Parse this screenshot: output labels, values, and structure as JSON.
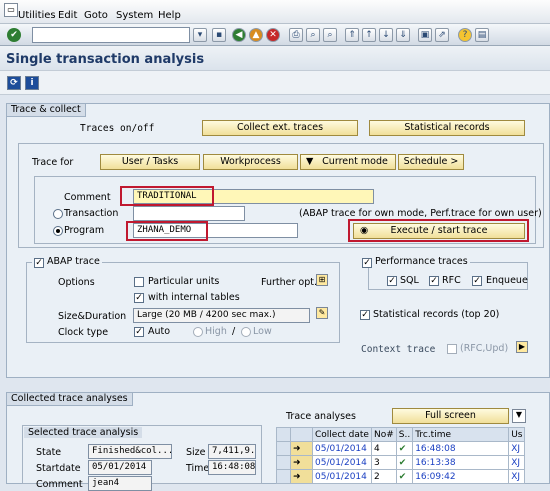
{
  "menu": {
    "items": [
      "Utilities",
      "Edit",
      "Goto",
      "System",
      "Help"
    ]
  },
  "page_title": "Single transaction analysis",
  "trace_collect": {
    "panel_title": "Trace & collect",
    "traces_onoff": "Traces on/off",
    "collect_ext_traces": "Collect ext. traces",
    "statistical_records": "Statistical records",
    "trace_for": "Trace for",
    "tabs": [
      "User / Tasks",
      "Workprocess",
      "Current mode",
      "Schedule >"
    ],
    "comment_label": "Comment",
    "comment_value": "TRADITIONAL",
    "transaction_label": "Transaction",
    "transaction_value": "",
    "program_label": "Program",
    "program_value": "ZHANA_DEMO",
    "note": "(ABAP trace for own mode, Perf.trace for own user)",
    "execute_button": "Execute / start trace"
  },
  "abap_trace": {
    "title": "ABAP trace",
    "checked": true,
    "options_label": "Options",
    "particular_units": "Particular units",
    "particular_units_checked": false,
    "further_opt": "Further opt.",
    "internal_tables": "with internal tables",
    "internal_tables_checked": true,
    "size_label": "Size&Duration",
    "size_value": "Large (20 MB / 4200 sec max.)",
    "clock_label": "Clock type",
    "auto": "Auto",
    "auto_checked": true,
    "high": "High",
    "low": "Low",
    "slash": "/"
  },
  "performance_traces": {
    "title": "Performance traces",
    "checked": true,
    "sql": "SQL",
    "rfc": "RFC",
    "enqueue": "Enqueue",
    "statistical_top": "Statistical records (top 20)",
    "context_trace": "Context trace",
    "context_value": "(RFC,Upd)"
  },
  "collected": {
    "panel_title": "Collected trace analyses",
    "selected_title": "Selected trace analysis",
    "state_label": "State",
    "state_value": "Finished&col...",
    "size_label": "Size",
    "size_value": "7,411,9...",
    "startdate_label": "Startdate",
    "startdate_value": "05/01/2014",
    "time_label": "Time",
    "time_value": "16:48:08",
    "comment_label": "Comment",
    "comment_value": "jean4",
    "trace_analyses": "Trace analyses",
    "full_screen": "Full screen",
    "columns": [
      "Collect date",
      "No#",
      "S..",
      "Trc.time",
      "Us"
    ],
    "rows": [
      {
        "date": "05/01/2014",
        "no": "4",
        "status": "✔",
        "time": "16:48:08",
        "user": "XJ"
      },
      {
        "date": "05/01/2014",
        "no": "3",
        "status": "✔",
        "time": "16:13:38",
        "user": "XJ"
      },
      {
        "date": "05/01/2014",
        "no": "2",
        "status": "✔",
        "time": "16:09:42",
        "user": "XJ"
      }
    ]
  }
}
